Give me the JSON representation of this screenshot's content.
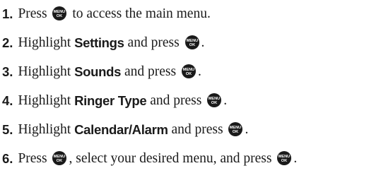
{
  "steps": [
    {
      "number": "1.",
      "parts": [
        {
          "t": "text",
          "v": "Press "
        },
        {
          "t": "key",
          "v": "MENU OK"
        },
        {
          "t": "text",
          "v": " to access the main menu."
        }
      ]
    },
    {
      "number": "2.",
      "parts": [
        {
          "t": "text",
          "v": "Highlight "
        },
        {
          "t": "term",
          "v": "Settings"
        },
        {
          "t": "text",
          "v": " and press "
        },
        {
          "t": "key",
          "v": "MENU OK"
        },
        {
          "t": "text",
          "v": "."
        }
      ]
    },
    {
      "number": "3.",
      "parts": [
        {
          "t": "text",
          "v": "Highlight "
        },
        {
          "t": "term",
          "v": "Sounds"
        },
        {
          "t": "text",
          "v": " and press "
        },
        {
          "t": "key",
          "v": "MENU OK"
        },
        {
          "t": "text",
          "v": "."
        }
      ]
    },
    {
      "number": "4.",
      "parts": [
        {
          "t": "text",
          "v": "Highlight "
        },
        {
          "t": "term",
          "v": "Ringer Type"
        },
        {
          "t": "text",
          "v": " and press "
        },
        {
          "t": "key",
          "v": "MENU OK"
        },
        {
          "t": "text",
          "v": "."
        }
      ]
    },
    {
      "number": "5.",
      "parts": [
        {
          "t": "text",
          "v": "Highlight "
        },
        {
          "t": "term",
          "v": "Calendar/Alarm"
        },
        {
          "t": "text",
          "v": " and press "
        },
        {
          "t": "key",
          "v": "MENU OK"
        },
        {
          "t": "text",
          "v": "."
        }
      ]
    },
    {
      "number": "6.",
      "parts": [
        {
          "t": "text",
          "v": "Press "
        },
        {
          "t": "key",
          "v": "MENU OK"
        },
        {
          "t": "text",
          "v": ", select your desired menu, and press "
        },
        {
          "t": "key",
          "v": "MENU OK"
        },
        {
          "t": "text",
          "v": "."
        }
      ]
    }
  ],
  "colors": {
    "text": "#1a1a1a",
    "key_fill": "#1a1a1a",
    "key_text": "#ffffff"
  },
  "icon": "menu-ok-key-icon"
}
